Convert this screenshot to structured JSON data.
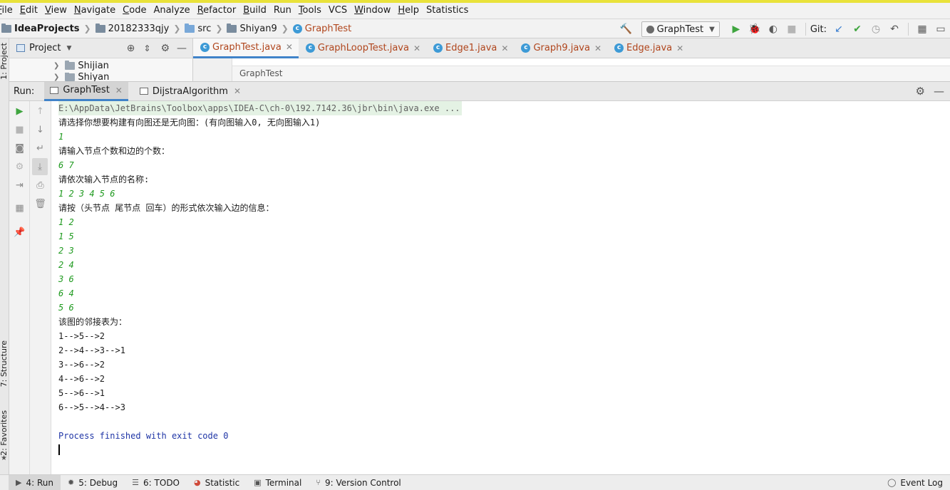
{
  "menubar": {
    "items": [
      "File",
      "Edit",
      "View",
      "Navigate",
      "Code",
      "Analyze",
      "Refactor",
      "Build",
      "Run",
      "Tools",
      "VCS",
      "Window",
      "Help",
      "Statistics"
    ]
  },
  "navbar": {
    "breadcrumb": [
      "IdeaProjects",
      "20182333qjy",
      "src",
      "Shiyan9",
      "GraphTest"
    ],
    "run_config": "GraphTest",
    "git_label": "Git:"
  },
  "left_strip": {
    "project_label": "1: Project",
    "structure_label": "7: Structure",
    "favorites_label": "2: Favorites"
  },
  "project_panel": {
    "title": "Project",
    "tree": [
      "Shijian",
      "Shiyan"
    ]
  },
  "editor": {
    "tabs": [
      "GraphTest.java",
      "GraphLoopTest.java",
      "Edge1.java",
      "Graph9.java",
      "Edge.java"
    ],
    "active_tab": 0,
    "breadcrumb": "GraphTest"
  },
  "run_panel": {
    "title": "Run:",
    "tabs": [
      "GraphTest",
      "DijstraAlgorithm"
    ],
    "active_tab": 0
  },
  "console": {
    "lines": [
      {
        "text": "E:\\AppData\\JetBrains\\Toolbox\\apps\\IDEA-C\\ch-0\\192.7142.36\\jbr\\bin\\java.exe ...",
        "kind": "cmd"
      },
      {
        "text": "请选择你想要构建有向图还是无向图：(有向图输入0, 无向图输入1)",
        "kind": "out"
      },
      {
        "text": "1",
        "kind": "inp"
      },
      {
        "text": "请输入节点个数和边的个数：",
        "kind": "out"
      },
      {
        "text": "6 7",
        "kind": "inp"
      },
      {
        "text": "请依次输入节点的名称:",
        "kind": "out"
      },
      {
        "text": "1 2 3 4 5 6",
        "kind": "inp"
      },
      {
        "text": "请按（头节点 尾节点 回车）的形式依次输入边的信息：",
        "kind": "out"
      },
      {
        "text": "1 2",
        "kind": "inp"
      },
      {
        "text": "1 5",
        "kind": "inp"
      },
      {
        "text": "2 3",
        "kind": "inp"
      },
      {
        "text": "2 4",
        "kind": "inp"
      },
      {
        "text": "3 6",
        "kind": "inp"
      },
      {
        "text": "6 4",
        "kind": "inp"
      },
      {
        "text": "5 6",
        "kind": "inp"
      },
      {
        "text": "该图的邻接表为：",
        "kind": "out"
      },
      {
        "text": "1-->5-->2",
        "kind": "out"
      },
      {
        "text": "2-->4-->3-->1",
        "kind": "out"
      },
      {
        "text": "3-->6-->2",
        "kind": "out"
      },
      {
        "text": "4-->6-->2",
        "kind": "out"
      },
      {
        "text": "5-->6-->1",
        "kind": "out"
      },
      {
        "text": "6-->5-->4-->3",
        "kind": "out"
      },
      {
        "text": "",
        "kind": "out"
      },
      {
        "text": "Process finished with exit code 0",
        "kind": "exit"
      }
    ]
  },
  "statusbar": {
    "tabs": [
      "4: Run",
      "5: Debug",
      "6: TODO",
      "Statistic",
      "Terminal",
      "9: Version Control"
    ],
    "event_log": "Event Log"
  },
  "colors": {
    "accent": "#4083c9",
    "input_green": "#1f9a1f",
    "exit_blue": "#1f35a6",
    "run_green": "#3fa53f"
  }
}
